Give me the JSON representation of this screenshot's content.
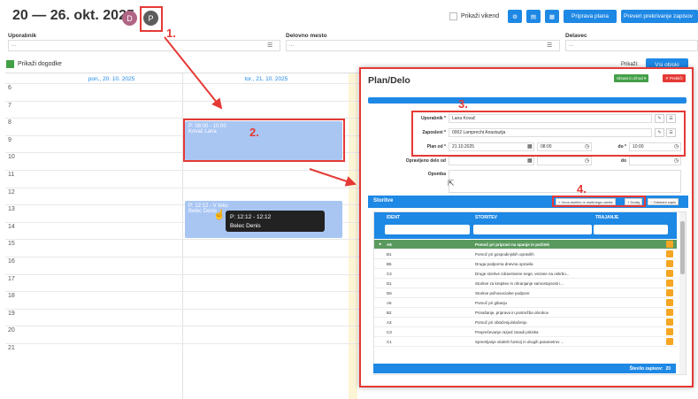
{
  "header": {
    "title": "20 — 26. okt. 2025",
    "avatars": [
      "D",
      "P"
    ]
  },
  "toolbar": {
    "show_weekend": "Prikaži vikend",
    "priprava_plana": "Priprava plana",
    "preveri": "Preveri prekrivanje zapisov"
  },
  "filters": {
    "uporabnik_label": "Uporabnik",
    "uporabnik_placeholder": "...",
    "delovno_mesto_label": "Delovno mesto",
    "delovno_mesto_placeholder": "...",
    "delavec_label": "Delavec",
    "delavec_placeholder": "..."
  },
  "show_events": "Prikaži dogodke",
  "right_controls": {
    "prikazi": "Prikaži:",
    "vsi_obiski": "Vsi obiski"
  },
  "days": [
    "pon., 20. 10. 2025",
    "tor., 21. 10. 2025"
  ],
  "hours": [
    "6",
    "7",
    "8",
    "9",
    "10",
    "11",
    "12",
    "13",
    "14",
    "15",
    "16",
    "17",
    "18",
    "19",
    "20",
    "21"
  ],
  "events": {
    "e1_time": "P: 08:00 - 10:00",
    "e1_name": "Kovač Lana",
    "e2_time": "P: 12:12 - V teku",
    "e2_name": "Belec Denis",
    "tip_time": "P: 12:12 - 12:12",
    "tip_name": "Belec Denis"
  },
  "annotations": [
    "1.",
    "2.",
    "3.",
    "4."
  ],
  "modal": {
    "title": "Plan/Delo",
    "save_button": "Shrani in izhod",
    "cancel_button": "Prekliči",
    "fields": {
      "uporabnik_label": "Uporabnik *",
      "uporabnik_value": "Lana Kovač",
      "zaposleni_label": "Zaposleni *",
      "zaposleni_value": "0002 Lamprecht Anastazija",
      "plan_od_label": "Plan od *",
      "plan_od_date": "21.10.2025",
      "plan_od_time": "08:00",
      "do_label": "do *",
      "do_time": "10:00",
      "opravljeno_label": "Opravljeno delo od",
      "opravljeno_do_label": "do",
      "opomba_label": "Opomba"
    },
    "storitve": {
      "title": "Storitve",
      "btn_vnos": "Vnos storitev iz osebnega načrta",
      "btn_dodaj": "Dodaj",
      "btn_odstrani": "Odstrani zapis",
      "columns": [
        "IDENT",
        "STORITEV",
        "TRAJANJE"
      ],
      "rows": [
        {
          "ident": "A6",
          "storitev": "Pomoč pri pripravi na spanje in počitek"
        },
        {
          "ident": "B1",
          "storitev": "Pomoč pri gospodinjskih opravilih"
        },
        {
          "ident": "B5",
          "storitev": "Druga podporna dnevna opravila"
        },
        {
          "ident": "C4",
          "storitev": "Druge storitve zdravstvene nege, vezane na oskrbo..."
        },
        {
          "ident": "D1",
          "storitev": "Storitve za krepitev in ohranjanje samostojnosti i..."
        },
        {
          "ident": "D5",
          "storitev": "Storitve psihosocialne podpore"
        },
        {
          "ident": "A5",
          "storitev": "Pomoč pri gibanju"
        },
        {
          "ident": "B2",
          "storitev": "Prinašanje, priprava in postrežba obrokov"
        },
        {
          "ident": "A3",
          "storitev": "Pomoč pri oblačenju/slačenju"
        },
        {
          "ident": "C3",
          "storitev": "Preprečevanje razjed zaradi pritiska"
        },
        {
          "ident": "C1",
          "storitev": "Spremljanje vitalnih funkcij in drugih parametrov ..."
        }
      ],
      "count_label": "Število zapisov:",
      "count": "20"
    }
  },
  "colors": {
    "accent": "#1e88e5",
    "annotation": "#e53935",
    "green": "#43a047",
    "event": "#a9c6f3"
  }
}
